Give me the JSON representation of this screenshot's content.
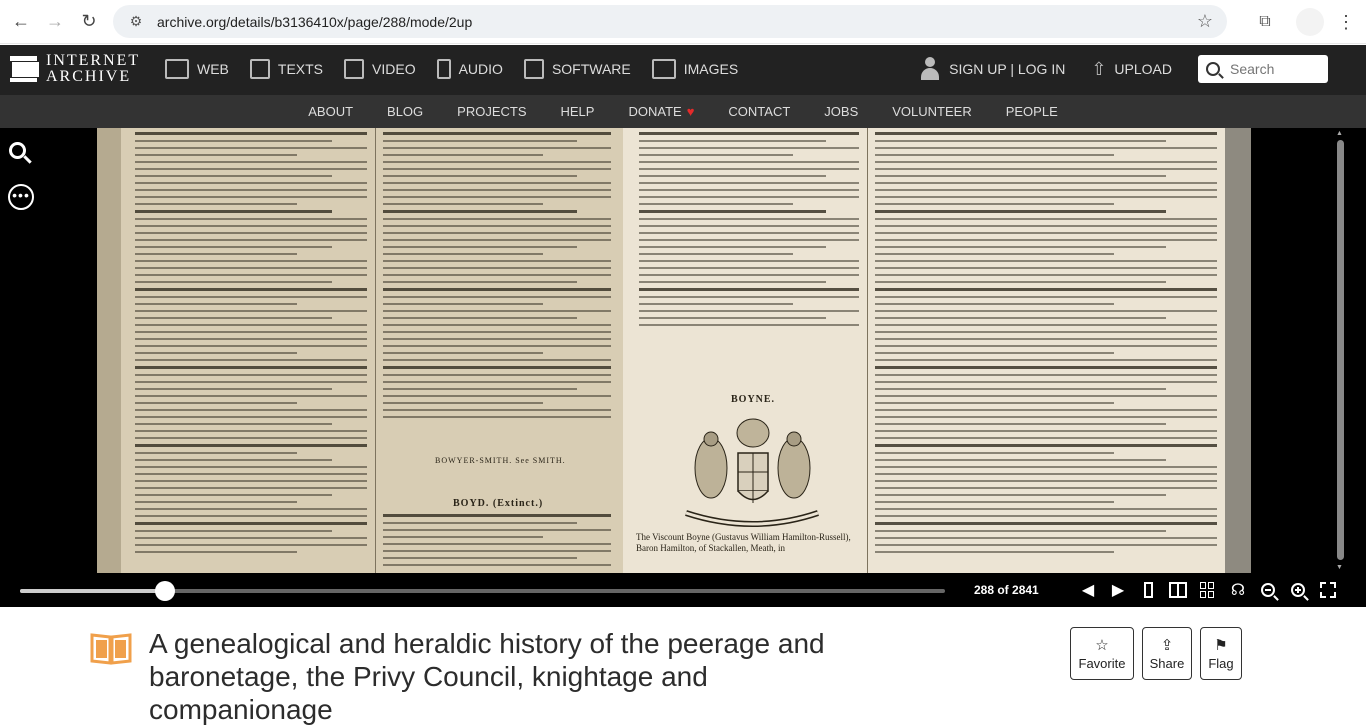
{
  "browser": {
    "url": "archive.org/details/b3136410x/page/288/mode/2up",
    "back_icon": "←",
    "forward_icon": "→",
    "reload_icon": "↻",
    "tune_icon": "⚙",
    "star_icon": "☆",
    "extensions_icon": "⧉",
    "menu_icon": "⋮"
  },
  "ia_nav": {
    "logo_line1": "INTERNET",
    "logo_line2": "ARCHIVE",
    "media": [
      "WEB",
      "TEXTS",
      "VIDEO",
      "AUDIO",
      "SOFTWARE",
      "IMAGES"
    ],
    "account": "SIGN UP | LOG IN",
    "upload": "UPLOAD",
    "search_placeholder": "Search"
  },
  "sub_nav": [
    "ABOUT",
    "BLOG",
    "PROJECTS",
    "HELP",
    "DONATE",
    "CONTACT",
    "JOBS",
    "VOLUNTEER",
    "PEOPLE"
  ],
  "reader": {
    "page_count": "288 of 2841",
    "progress_fraction": 0.1,
    "headings": {
      "left_a": "BOWYER-SMITH.  See SMITH.",
      "left_b": "BOYD.  (Extinct.)",
      "right_a": "BOYNE."
    },
    "caption": "The Viscount Boyne (Gustavus William Hamilton-Russell), Baron Hamilton, of Stackallen, Meath, in"
  },
  "item": {
    "title": "A genealogical and heraldic history of the peerage and baronetage, the Privy Council, knightage and companionage",
    "favorite": "Favorite",
    "share": "Share",
    "flag": "Flag"
  },
  "colors": {
    "ia_top": "#222222",
    "ia_sub": "#333333",
    "donate_heart": "#e52a2a",
    "book_icon": "#f0a04b"
  }
}
